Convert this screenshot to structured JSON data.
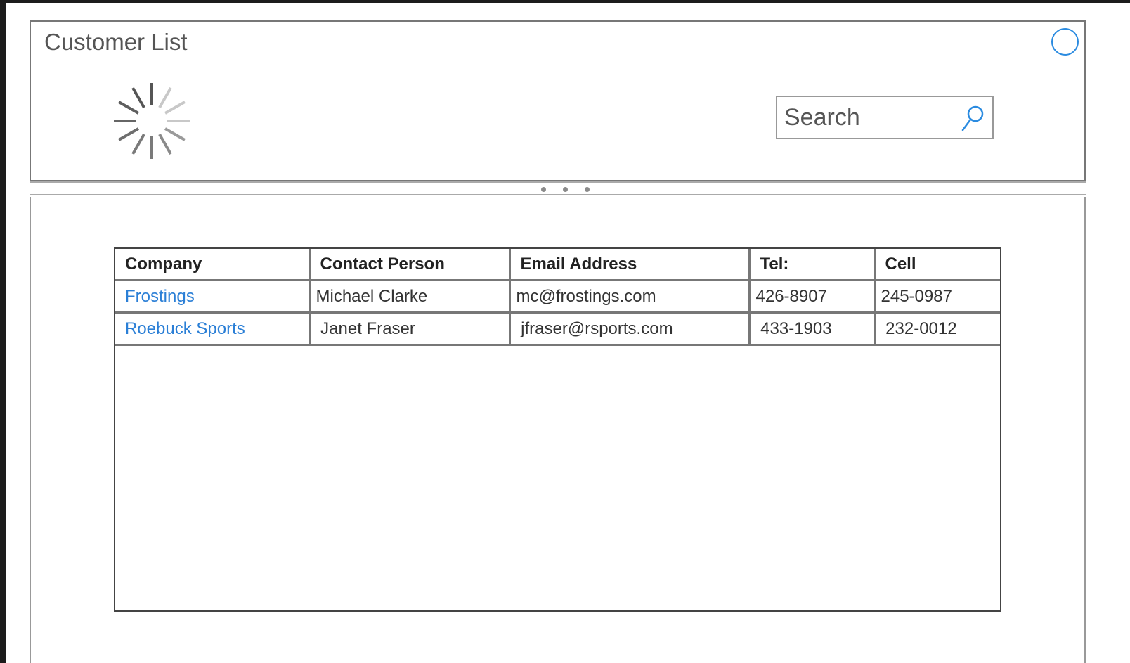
{
  "window": {
    "title": "Customer List"
  },
  "search": {
    "placeholder": "Search"
  },
  "table": {
    "columns": [
      "Company",
      "Contact Person",
      "Email Address",
      "Tel:",
      "Cell"
    ],
    "rows": [
      {
        "company": "Frostings",
        "contact": "Michael Clarke",
        "email": "mc@frostings.com",
        "tel": "426-8907",
        "cell": "245-0987"
      },
      {
        "company": "Roebuck Sports",
        "contact": " Janet Fraser",
        "email": " jfraser@rsports.com",
        "tel": " 433-1903",
        "cell": " 232-0012"
      }
    ]
  },
  "colors": {
    "accent": "#2b8be0",
    "link": "#2b7fd6",
    "border": "#777777"
  },
  "icons": {
    "status": "circle-icon",
    "loading": "spinner-icon",
    "search": "search-icon",
    "splitter": "drag-handle-icon"
  }
}
